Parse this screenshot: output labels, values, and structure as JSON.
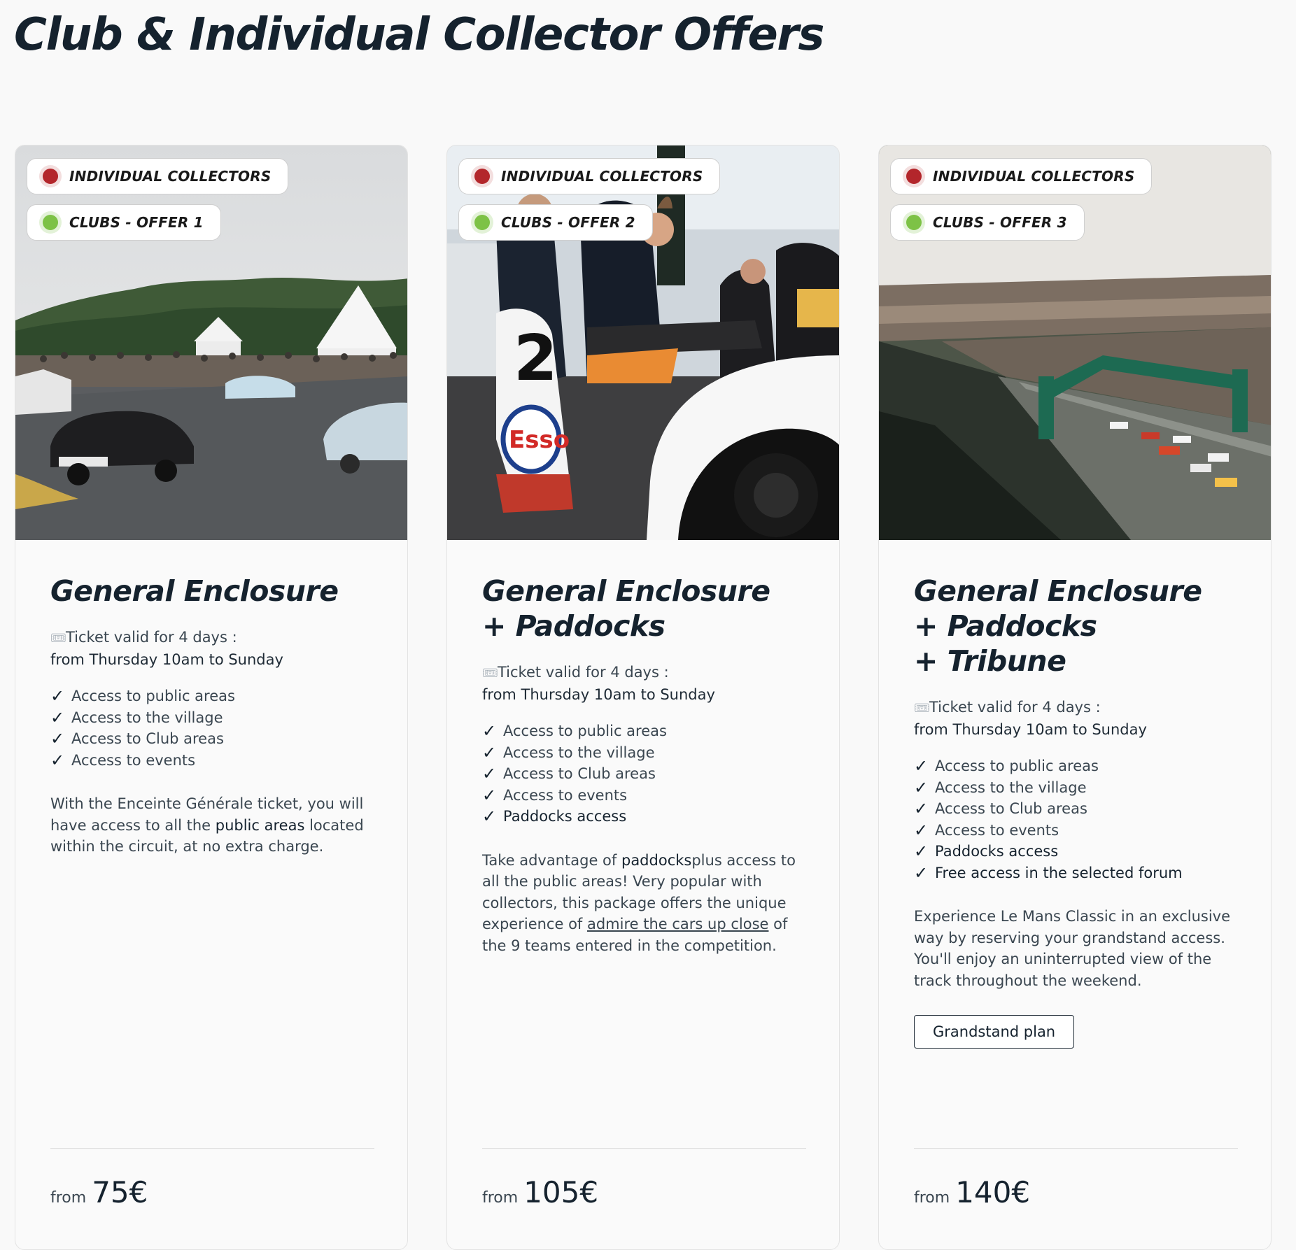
{
  "page_title": "Club & Individual Collector Offers",
  "ticket_icon": "ticket-icon",
  "cards": [
    {
      "badge_individual": "INDIVIDUAL COLLECTORS",
      "badge_club": "CLUBS - OFFER 1",
      "title_lines": [
        "General Enclosure"
      ],
      "ticket_line1": "Ticket valid for 4 days :",
      "ticket_line2": "from Thursday 10am to Sunday",
      "features": [
        "Access to public areas",
        "Access to the village",
        "Access to Club areas",
        "Access to events"
      ],
      "description": {
        "part1": "With the Enceinte Générale ticket, you will have access to all the ",
        "em": "public areas",
        "part2": " located within the circuit, at no extra charge."
      },
      "price_prefix": "from",
      "price": "75€"
    },
    {
      "badge_individual": "INDIVIDUAL COLLECTORS",
      "badge_club": "CLUBS - OFFER 2",
      "title_lines": [
        "General Enclosure",
        "+ Paddocks"
      ],
      "ticket_line1": "Ticket valid for 4 days :",
      "ticket_line2": "from Thursday 10am to Sunday",
      "features": [
        "Access to public areas",
        "Access to the village",
        "Access to Club areas",
        "Access to events"
      ],
      "features_strong": [
        "Paddocks access"
      ],
      "description": {
        "part1": "Take advantage of ",
        "em": "paddocks",
        "part2": "plus access to all the public areas! Very popular with collectors, this package offers the unique experience of ",
        "link": "admire the cars up close",
        "part3": " of the 9 teams entered in the competition."
      },
      "price_prefix": "from",
      "price": "105€"
    },
    {
      "badge_individual": "INDIVIDUAL COLLECTORS",
      "badge_club": "CLUBS - OFFER 3",
      "title_lines": [
        "General Enclosure",
        "+ Paddocks",
        "+ Tribune"
      ],
      "ticket_line1": "Ticket valid for 4 days :",
      "ticket_line2": "from Thursday 10am to Sunday",
      "features": [
        "Access to public areas",
        "Access to the village",
        "Access to Club areas",
        "Access to events"
      ],
      "features_strong": [
        "Paddocks access",
        "Free access in the selected forum"
      ],
      "description": {
        "part1": "Experience Le Mans Classic in an exclusive way by reserving your grandstand access. You'll enjoy an uninterrupted view of the track throughout the weekend."
      },
      "button_label": "Grandstand plan",
      "price_prefix": "from",
      "price": "140€"
    }
  ],
  "colors": {
    "individual_dot": "#b3262b",
    "club_dot": "#7dc246",
    "title_text": "#15222e"
  }
}
